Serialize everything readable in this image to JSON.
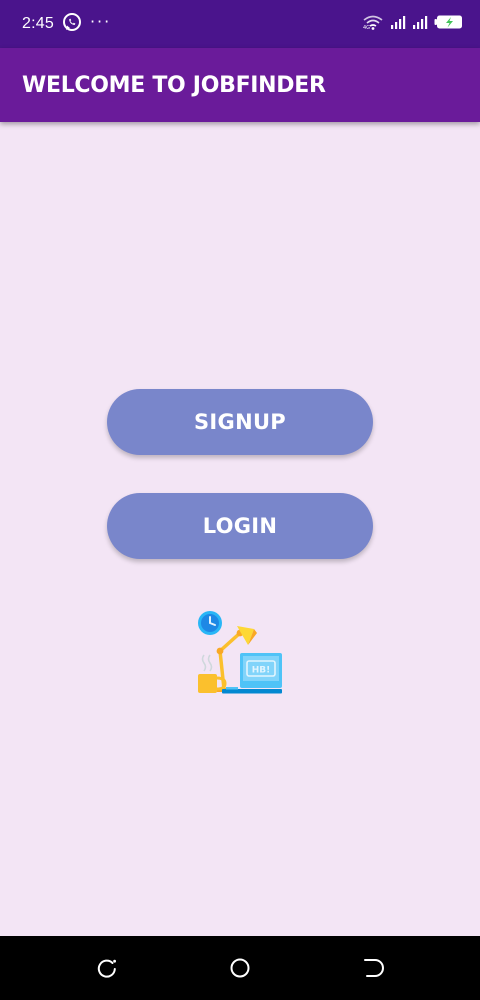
{
  "status_bar": {
    "time": "2:45",
    "more_indicator": "···",
    "icons": [
      "whatsapp-icon",
      "wifi-icon",
      "signal-icon",
      "signal-icon",
      "battery-charging-icon"
    ]
  },
  "app_bar": {
    "title": "WELCOME TO JOBFINDER"
  },
  "main": {
    "signup_label": "SIGNUP",
    "login_label": "LOGIN",
    "illustration": "desk-lamp-computer-illustration"
  },
  "nav_bar": {
    "icons": [
      "recent-apps-icon",
      "home-icon",
      "back-icon"
    ]
  },
  "colors": {
    "status_bar": "#4a148c",
    "app_bar": "#6a1b9a",
    "background": "#f3e5f5",
    "button": "#7986cb",
    "nav_bar": "#000000"
  }
}
